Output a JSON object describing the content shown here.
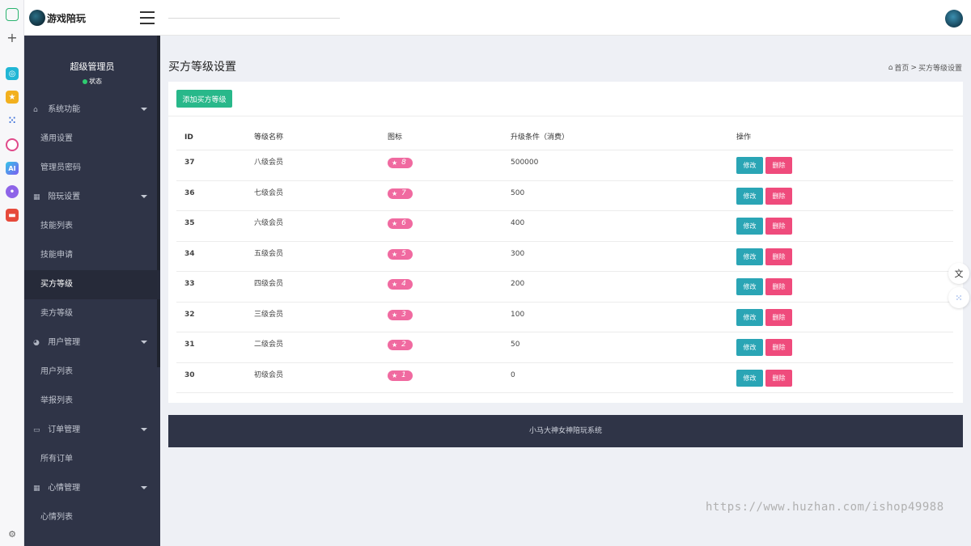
{
  "app": {
    "title": "游戏陪玩"
  },
  "strip": {
    "icons": [
      {
        "name": "home-icon",
        "color": "#2ab36f"
      },
      {
        "name": "plus-icon",
        "color": "#555555"
      },
      {
        "name": "chat-app-icon",
        "color": "#21b6d5"
      },
      {
        "name": "star-app-icon",
        "color": "#f2b01e"
      },
      {
        "name": "grid-app-icon",
        "color": "#3a6fd8"
      },
      {
        "name": "circle-app-icon",
        "color": "#e04a8a"
      },
      {
        "name": "ai-app-icon",
        "color": "#3b8ff0"
      },
      {
        "name": "bubble-app-icon",
        "color": "#8e64e8"
      },
      {
        "name": "gamepad-app-icon",
        "color": "#e64a3b"
      },
      {
        "name": "settings-icon",
        "color": "#666666"
      }
    ],
    "ai_label": "AI"
  },
  "sidebar": {
    "profile_name": "超级管理员",
    "profile_status": "状态",
    "groups": [
      {
        "label": "系统功能",
        "items": [
          "通用设置",
          "管理员密码"
        ]
      },
      {
        "label": "陪玩设置",
        "items": [
          "技能列表",
          "技能申请",
          "买方等级",
          "卖方等级"
        ]
      },
      {
        "label": "用户管理",
        "items": [
          "用户列表",
          "举报列表"
        ]
      },
      {
        "label": "订单管理",
        "items": [
          "所有订单"
        ]
      },
      {
        "label": "心情管理",
        "items": [
          "心情列表"
        ]
      }
    ],
    "active_item": "买方等级"
  },
  "main": {
    "page_title": "买方等级设置",
    "breadcrumb_home": "首页",
    "breadcrumb_sep": ">",
    "breadcrumb_current": "买方等级设置",
    "add_button": "添加买方等级",
    "columns": [
      "ID",
      "等级名称",
      "图标",
      "升级条件（消费）",
      "操作"
    ],
    "rows": [
      {
        "id": "37",
        "name": "八级会员",
        "icon_level": "8",
        "condition": "500000"
      },
      {
        "id": "36",
        "name": "七级会员",
        "icon_level": "7",
        "condition": "500"
      },
      {
        "id": "35",
        "name": "六级会员",
        "icon_level": "6",
        "condition": "400"
      },
      {
        "id": "34",
        "name": "五级会员",
        "icon_level": "5",
        "condition": "300"
      },
      {
        "id": "33",
        "name": "四级会员",
        "icon_level": "4",
        "condition": "200"
      },
      {
        "id": "32",
        "name": "三级会员",
        "icon_level": "3",
        "condition": "100"
      },
      {
        "id": "31",
        "name": "二级会员",
        "icon_level": "2",
        "condition": "50"
      },
      {
        "id": "30",
        "name": "初级会员",
        "icon_level": "1",
        "condition": "0"
      }
    ],
    "edit_label": "修改",
    "delete_label": "删除",
    "footer": "小马大神女神陪玩系统",
    "watermark": "https://www.huzhan.com/ishop49988"
  },
  "colors": {
    "sidebar_bg": "#2f3447",
    "add_button": "#28b88a",
    "edit_button": "#2aa5b5",
    "delete_button": "#ef4b7c",
    "badge": "#f06aa0"
  }
}
